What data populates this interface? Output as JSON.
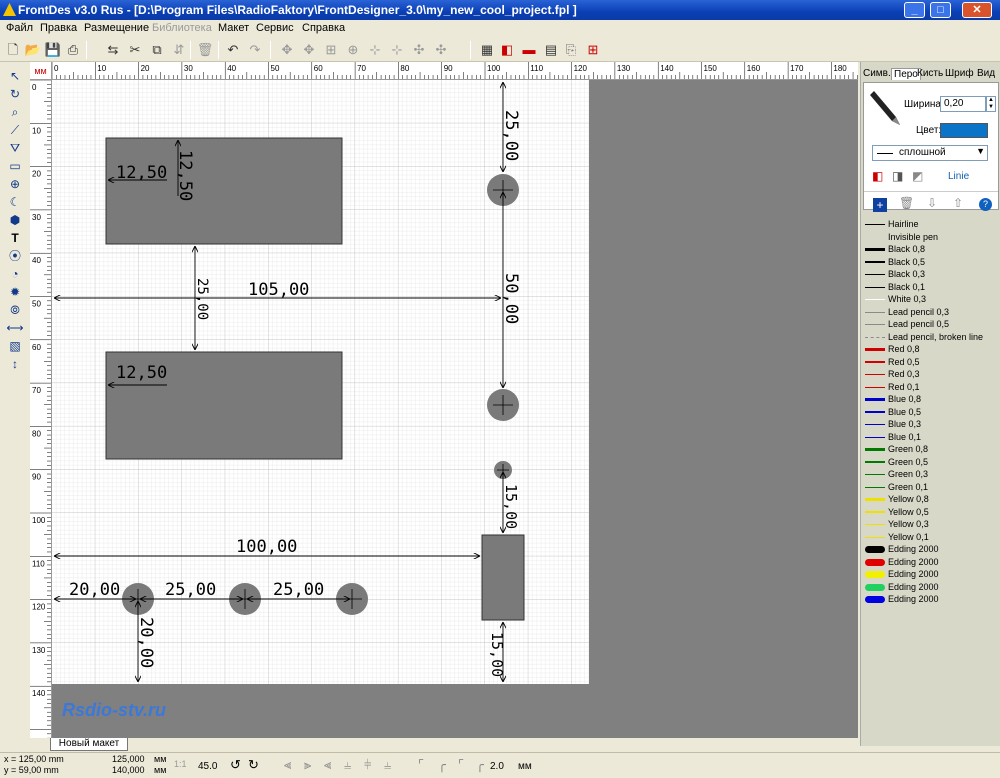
{
  "window": {
    "title": "FrontDes v3.0 Rus - [D:\\Program Files\\RadioFaktory\\FrontDesigner_3.0\\my_new_cool_project.fpl     ]",
    "min": "_",
    "max": "□",
    "close": "✕"
  },
  "menu": [
    "Файл",
    "Правка",
    "Размещение",
    "Библиотека",
    "Макет",
    "Сервис",
    "Справка"
  ],
  "menu_disabled": "Библиотека",
  "ruler": {
    "unit": "мм",
    "top_ticks": [
      "0",
      "10",
      "20",
      "30",
      "40",
      "50",
      "60",
      "70",
      "80",
      "90",
      "100",
      "110",
      "120",
      "130",
      "140",
      "150",
      "160",
      "170",
      "180"
    ],
    "left_ticks": [
      "0",
      "10",
      "20",
      "30",
      "40",
      "50",
      "60",
      "70",
      "80",
      "90",
      "100",
      "110",
      "120",
      "130",
      "140"
    ]
  },
  "dimensions": {
    "d1": "12,50",
    "d2": "12,50",
    "d3": "25,00",
    "d4": "105,00",
    "d5": "12,50",
    "d6": "25,00",
    "d7": "50,00",
    "d8": "15,00",
    "d9": "100,00",
    "d10": "20,00",
    "d11": "25,00",
    "d12": "25,00",
    "d13": "20,00",
    "d14": "15,00"
  },
  "watermark": "Rsdio-stv.ru",
  "panel": {
    "tabs": [
      "Симв.",
      "Перо",
      "Кисть",
      "Шриф",
      "Вид"
    ],
    "width_label": "Ширина:",
    "width_value": "0,20",
    "color_label": "Цвет:",
    "color_value": "#0a74c8",
    "style_value": "сплошной",
    "linie": "Linie",
    "lines": [
      {
        "name": "Hairline",
        "color": "#000000",
        "w": 1
      },
      {
        "name": "Invisible pen",
        "color": "transparent",
        "w": 1
      },
      {
        "name": "Black 0,8",
        "color": "#000000",
        "w": 3
      },
      {
        "name": "Black 0,5",
        "color": "#000000",
        "w": 2
      },
      {
        "name": "Black 0,3",
        "color": "#000000",
        "w": 1
      },
      {
        "name": "Black 0,1",
        "color": "#000000",
        "w": 1
      },
      {
        "name": "White 0,3",
        "color": "#ffffff",
        "w": 1
      },
      {
        "name": "Lead pencil 0,3",
        "color": "#8a8a8a",
        "w": 1
      },
      {
        "name": "Lead pencil 0,5",
        "color": "#8a8a8a",
        "w": 1
      },
      {
        "name": "Lead pencil, broken line",
        "color": "#8a8a8a",
        "w": 1
      },
      {
        "name": "Red 0,8",
        "color": "#d00000",
        "w": 3
      },
      {
        "name": "Red 0,5",
        "color": "#d00000",
        "w": 2
      },
      {
        "name": "Red 0,3",
        "color": "#d00000",
        "w": 1
      },
      {
        "name": "Red 0,1",
        "color": "#d00000",
        "w": 1
      },
      {
        "name": "Blue 0,8",
        "color": "#0000cc",
        "w": 3
      },
      {
        "name": "Blue 0,5",
        "color": "#0000cc",
        "w": 2
      },
      {
        "name": "Blue 0,3",
        "color": "#0000cc",
        "w": 1
      },
      {
        "name": "Blue 0,1",
        "color": "#0000cc",
        "w": 1
      },
      {
        "name": "Green 0,8",
        "color": "#007a00",
        "w": 3
      },
      {
        "name": "Green 0,5",
        "color": "#007a00",
        "w": 2
      },
      {
        "name": "Green 0,3",
        "color": "#007a00",
        "w": 1
      },
      {
        "name": "Green 0,1",
        "color": "#007a00",
        "w": 1
      },
      {
        "name": "Yellow 0,8",
        "color": "#f0e000",
        "w": 3
      },
      {
        "name": "Yellow 0,5",
        "color": "#f0e000",
        "w": 2
      },
      {
        "name": "Yellow 0,3",
        "color": "#f0e000",
        "w": 1
      },
      {
        "name": "Yellow 0,1",
        "color": "#f0e000",
        "w": 1
      },
      {
        "name": "Edding 2000",
        "color": "#000000",
        "w": 7
      },
      {
        "name": "Edding 2000",
        "color": "#e00000",
        "w": 7
      },
      {
        "name": "Edding 2000",
        "color": "#f0f000",
        "w": 7
      },
      {
        "name": "Edding 2000",
        "color": "#20d060",
        "w": 7
      },
      {
        "name": "Edding 2000",
        "color": "#0000e0",
        "w": 7
      }
    ]
  },
  "tab_name": "Новый макет",
  "status": {
    "x": "x = 125,00 mm",
    "y": "y = 59,00 mm",
    "w": "125,000",
    "h": "140,000",
    "unit1": "мм",
    "unit2": "мм",
    "scale": "1:1",
    "angle": "45.0",
    "step": "2.0",
    "unit3": "мм"
  }
}
